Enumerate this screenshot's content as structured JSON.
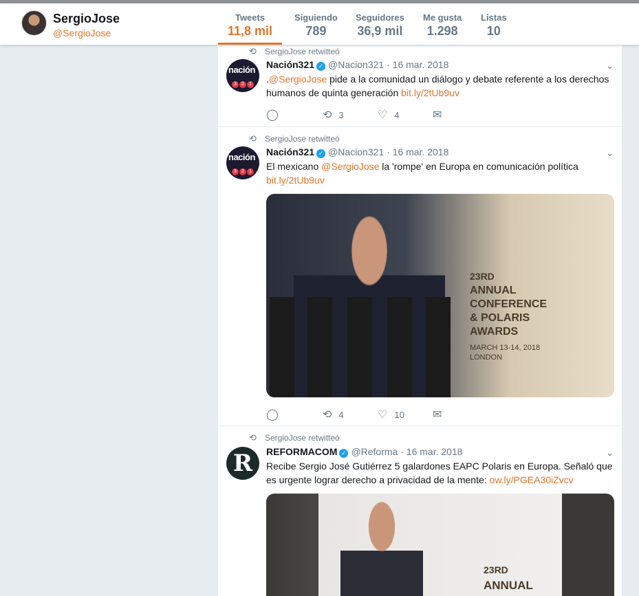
{
  "profile": {
    "name": "SergioJose",
    "handle": "@SergioJose"
  },
  "stats": [
    {
      "label": "Tweets",
      "value": "11,8 mil"
    },
    {
      "label": "Siguiendo",
      "value": "789"
    },
    {
      "label": "Seguidores",
      "value": "36,9 mil"
    },
    {
      "label": "Me gusta",
      "value": "1.298"
    },
    {
      "label": "Listas",
      "value": "10"
    }
  ],
  "colors": {
    "accent": "#e0752a",
    "verified": "#1da1f2",
    "muted": "#657786"
  },
  "tweets": [
    {
      "retweet_label": "SergioJose retwitteó",
      "name": "Nación321",
      "handle": "@Nacion321",
      "date": "16 mar. 2018",
      "text_prefix": ".",
      "mention": "@SergioJose",
      "text": " pide a la comunidad un diálogo y debate referente a los derechos humanos de quinta generación ",
      "link": "bit.ly/2tUb9uv",
      "retweets": "3",
      "likes": "4"
    },
    {
      "retweet_label": "SergioJose retwitteó",
      "name": "Nación321",
      "handle": "@Nacion321",
      "date": "16 mar. 2018",
      "text_prefix": "El mexicano ",
      "mention": "@SergioJose",
      "text": " la 'rompe' en Europa en comunicación política",
      "link": "bit.ly/2tUb9uv",
      "image_text": {
        "num": "23RD",
        "l1": "ANNUAL",
        "l2": "CONFERENCE",
        "l3": "& POLARIS",
        "l4": "AWARDS",
        "l5": "MARCH 13-14, 2018",
        "l6": "LONDON"
      },
      "retweets": "4",
      "likes": "10"
    },
    {
      "retweet_label": "SergioJose retwitteó",
      "name": "REFORMACOM",
      "handle": "@Reforma",
      "date": "16 mar. 2018",
      "text": "Recibe Sergio José Gutiérrez 5 galardones EAPC Polaris en Europa. Señaló que es urgente lograr derecho a privacidad de la mente: ",
      "link": "ow.ly/PGEA30iZvcv",
      "image_text": {
        "num": "23RD",
        "l1": "ANNUAL"
      }
    }
  ],
  "avatar_text": {
    "nacion": "nación",
    "digits": [
      "3",
      "2",
      "1"
    ],
    "reforma": "R"
  }
}
